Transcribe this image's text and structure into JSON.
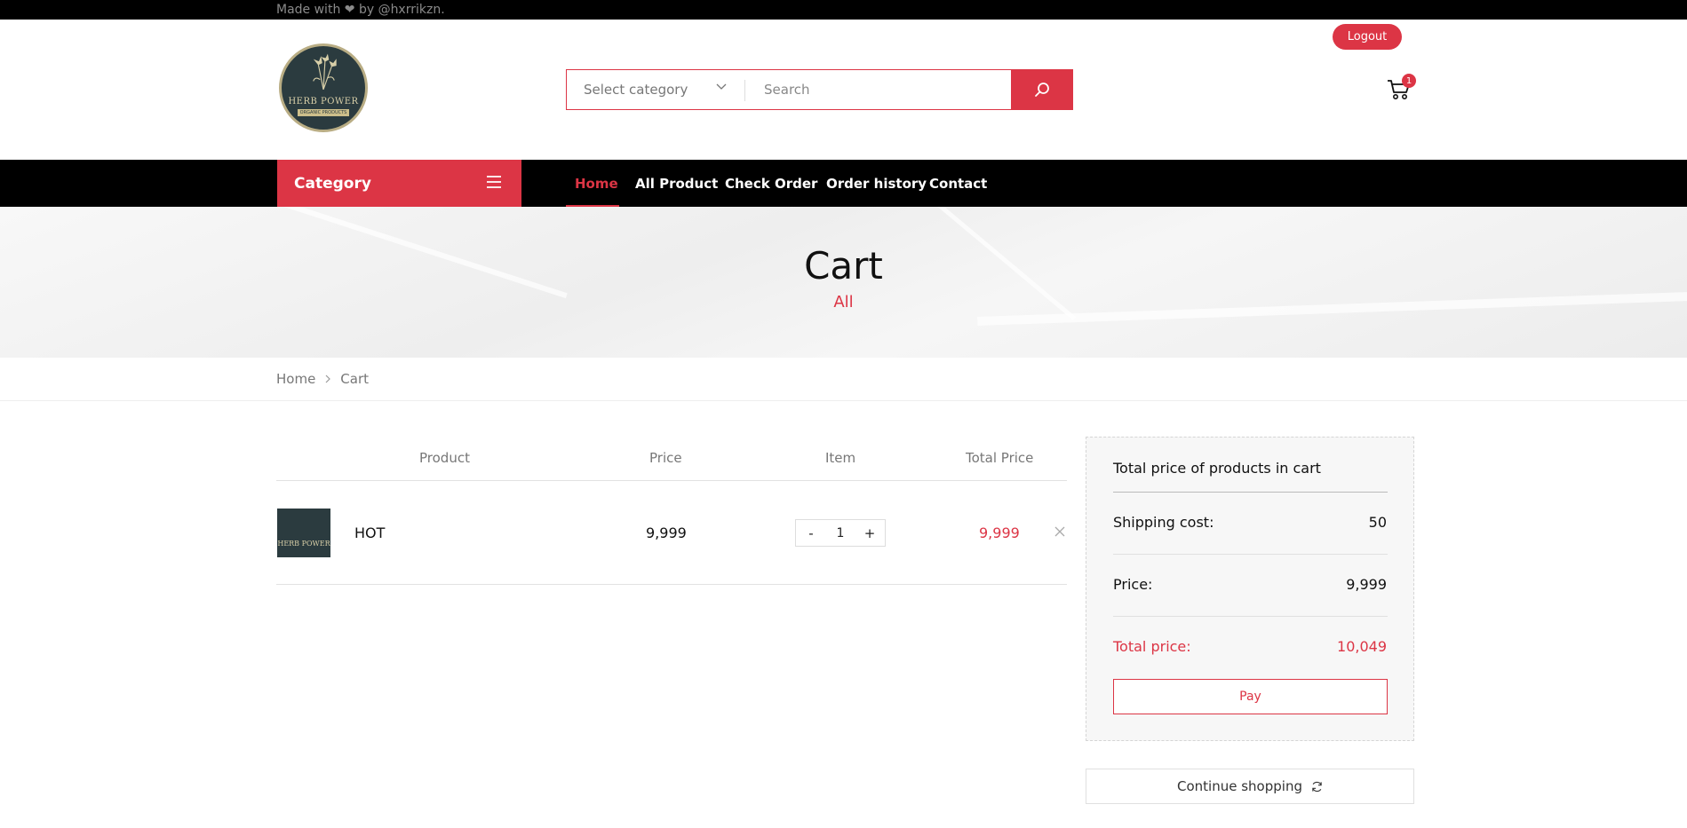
{
  "topbar": {
    "made_with": "Made with ❤ by @hxrrikzn."
  },
  "logo": {
    "brand": "HERB POWER",
    "tagline": "ORGANIC PRODUCTS"
  },
  "search": {
    "category_label": "Select category",
    "placeholder": "Search"
  },
  "header": {
    "logout_label": "Logout",
    "cart_count": "1"
  },
  "nav": {
    "category_label": "Category",
    "items": [
      "Home",
      "All Product",
      "Check Order",
      "Order history",
      "Contact"
    ],
    "active": "Home"
  },
  "hero": {
    "title": "Cart",
    "subtitle": "All"
  },
  "breadcrumb": {
    "home": "Home",
    "current": "Cart"
  },
  "cart_table": {
    "headers": [
      "Product",
      "Price",
      "Item",
      "Total Price"
    ],
    "rows": [
      {
        "name": "HOT",
        "price": "9,999",
        "qty": "1",
        "total": "9,999"
      }
    ],
    "minus": "-",
    "plus": "+"
  },
  "summary": {
    "title": "Total price of products in cart",
    "shipping_label": "Shipping cost:",
    "shipping_value": "50",
    "price_label": "Price:",
    "price_value": "9,999",
    "total_label": "Total price:",
    "total_value": "10,049",
    "pay_label": "Pay"
  },
  "continue_label": "Continue shopping",
  "colors": {
    "accent": "#dc3545",
    "dark": "#000000",
    "logo_bg": "#2b3b3f"
  },
  "icons": [
    "heart-icon",
    "chevron-down-icon",
    "search-icon",
    "cart-icon",
    "menu-icon",
    "chevron-right-icon",
    "close-icon",
    "refresh-icon"
  ]
}
